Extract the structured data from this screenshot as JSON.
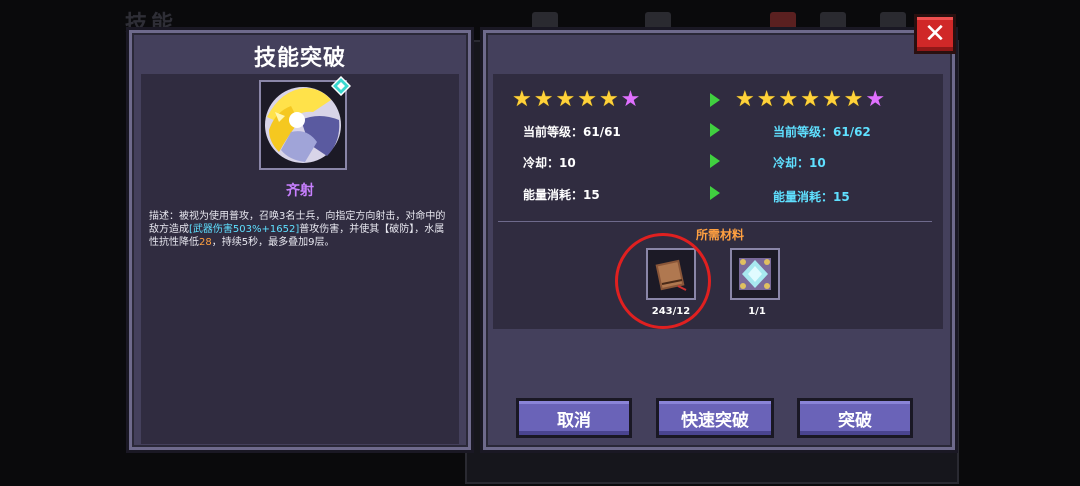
{
  "background": {
    "title": "技能"
  },
  "dialog": {
    "title": "技能突破",
    "close_label": "✕"
  },
  "skill": {
    "name": "齐射",
    "description_parts": {
      "p1": "描述：被视为使用普攻，召唤3名士兵，向指定方向射击，对命中的敌方造成",
      "p2": "[武器伤害503%+1652]",
      "p3": "普攻伤害，并使其【破防】，水属性抗性降低",
      "p4": "28",
      "p5": "，持续5秒，最多叠加9层。"
    }
  },
  "current": {
    "stars_gold": 5,
    "stars_pink": 1,
    "level_label": "当前等级：61/61",
    "cooldown_label": "冷却：10",
    "energy_label": "能量消耗：15"
  },
  "next": {
    "stars_gold": 6,
    "stars_pink": 1,
    "level_label": "当前等级：61/62",
    "cooldown_label": "冷却：10",
    "energy_label": "能量消耗：15"
  },
  "materials": {
    "title": "所需材料",
    "items": [
      {
        "icon": "book-icon",
        "count": "243/12"
      },
      {
        "icon": "crystal-icon",
        "count": "1/1"
      }
    ]
  },
  "buttons": {
    "cancel": "取消",
    "quick_breakthrough": "快速突破",
    "breakthrough": "突破"
  },
  "colors": {
    "panel": "#44405c",
    "button": "#6a63b8",
    "accent_cyan": "#5fe0ff",
    "accent_orange": "#ffa040",
    "skill_name": "#c880ff",
    "close": "#d02828"
  }
}
